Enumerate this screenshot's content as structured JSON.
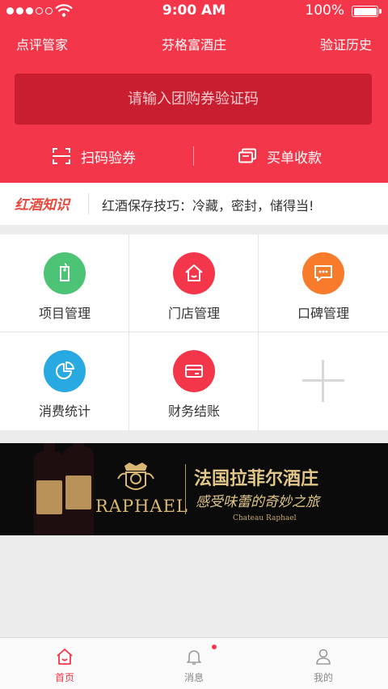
{
  "status_bar": {
    "time": "9:00 AM",
    "battery": "100%"
  },
  "header": {
    "left_link": "点评管家",
    "title": "芬格富酒庄",
    "right_link": "验证历史",
    "coupon_placeholder": "请输入团购券验证码",
    "actions": [
      {
        "label": "扫码验券",
        "icon": "scan-icon"
      },
      {
        "label": "买单收款",
        "icon": "cards-icon"
      }
    ]
  },
  "news": {
    "brand": "红酒知识",
    "text": "红酒保存技巧：冷藏，密封，储得当!"
  },
  "grid": {
    "items": [
      {
        "label": "项目管理",
        "icon": "tag-icon",
        "color": "#4cc375"
      },
      {
        "label": "门店管理",
        "icon": "store-icon",
        "color": "#f4364a"
      },
      {
        "label": "口碑管理",
        "icon": "chat-bubble-icon",
        "color": "#f77b2a"
      },
      {
        "label": "消费统计",
        "icon": "pie-chart-icon",
        "color": "#28a9e1"
      },
      {
        "label": "财务结账",
        "icon": "card-icon",
        "color": "#f4364a"
      },
      {
        "label": "",
        "icon": "plus-icon",
        "color": "#d8d8d8"
      }
    ]
  },
  "banner": {
    "brand": "RAPHAEL",
    "title": "法国拉菲尔酒庄",
    "subtitle": "感受味蕾的奇妙之旅",
    "small": "Chateau Raphael"
  },
  "tabbar": {
    "items": [
      {
        "label": "首页",
        "icon": "home-icon",
        "active": true
      },
      {
        "label": "消息",
        "icon": "bell-icon",
        "active": false
      },
      {
        "label": "我的",
        "icon": "user-icon",
        "active": false
      }
    ]
  },
  "colors": {
    "brand_red": "#f4364a",
    "input_red": "#c81e30",
    "gold": "#e2c68a"
  }
}
